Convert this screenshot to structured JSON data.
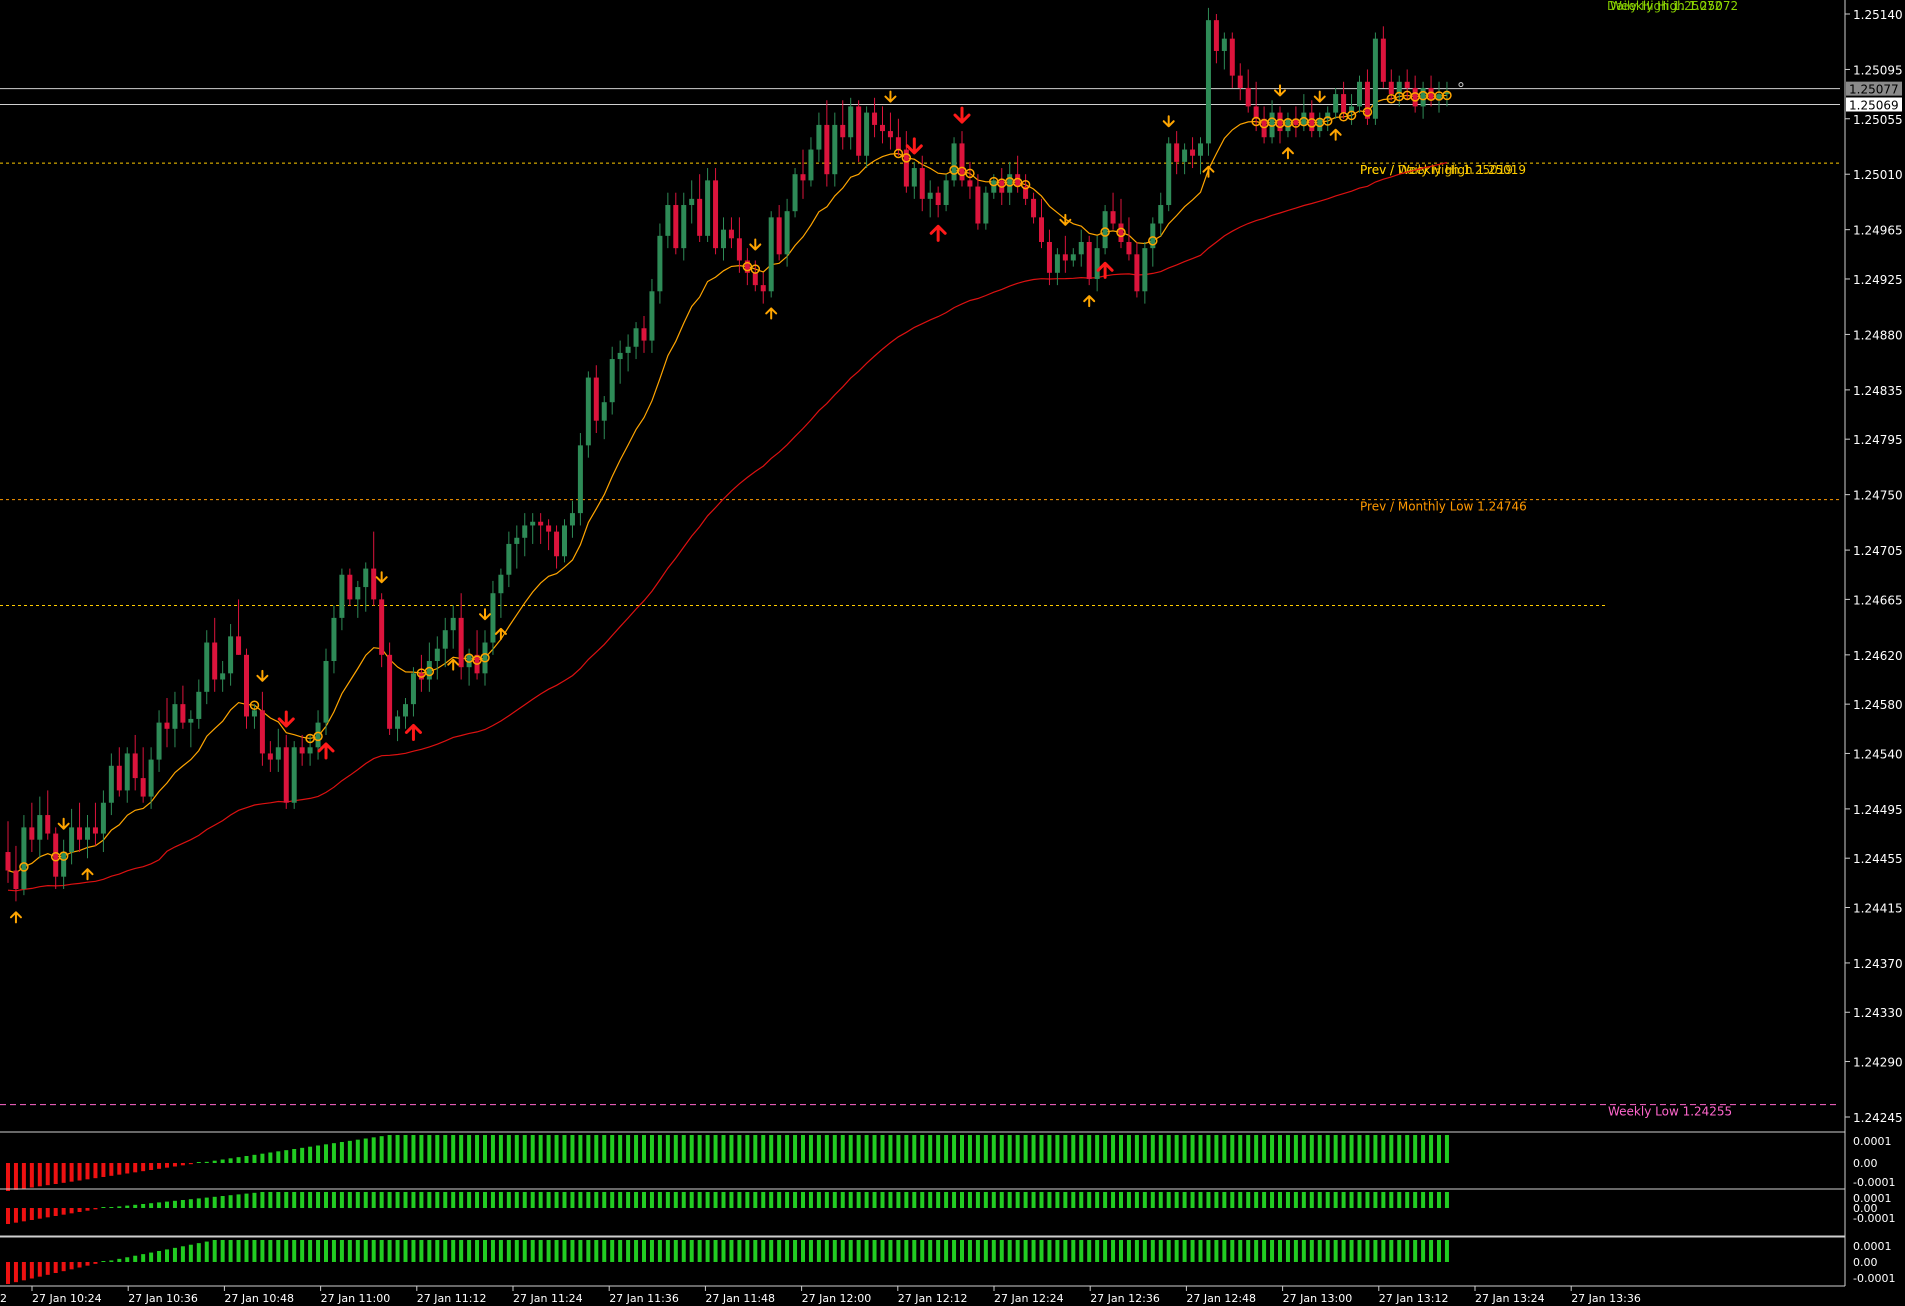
{
  "chart_data": {
    "type": "candlestick",
    "symbol_timeframe": "M1",
    "price_axis_ticks": [
      "1.25140",
      "1.25095",
      "1.25055",
      "1.25010",
      "1.24965",
      "1.24925",
      "1.24880",
      "1.24835",
      "1.24795",
      "1.24750",
      "1.24705",
      "1.24665",
      "1.24620",
      "1.24580",
      "1.24540",
      "1.24495",
      "1.24455",
      "1.24415",
      "1.24370",
      "1.24330",
      "1.24290",
      "1.24245"
    ],
    "ylim": [
      1.24225,
      1.2515
    ],
    "time_axis_ticks": [
      "27 Jan 10:24",
      "27 Jan 10:36",
      "27 Jan 10:48",
      "27 Jan 11:00",
      "27 Jan 11:12",
      "27 Jan 11:24",
      "27 Jan 11:36",
      "27 Jan 11:48",
      "27 Jan 12:00",
      "27 Jan 12:12",
      "27 Jan 12:24",
      "27 Jan 12:36",
      "27 Jan 12:48",
      "27 Jan 13:00",
      "27 Jan 13:12",
      "27 Jan 13:24",
      "27 Jan 13:36"
    ],
    "left_edge_label": "2",
    "bid_label": "1.25077",
    "ask_label": "1.25069",
    "bid_price": 1.25077,
    "ask_price": 1.25069,
    "levels": [
      {
        "label": "Weekly High 1.25072",
        "price": 1.25152,
        "color": "#8cd600",
        "style": "dash-long",
        "overlay_label": "Daily High 1.25072"
      },
      {
        "label": "Prev / Weekly High 1.25019",
        "price": 1.25019,
        "color": "#ffcc00",
        "style": "dot",
        "overlay_label": "Prev / Daily High 1.25019"
      },
      {
        "label": "Prev / Monthly Low 1.24746",
        "price": 1.24746,
        "color": "#ff9900",
        "style": "dot"
      },
      {
        "label": "",
        "price": 1.2466,
        "color": "#ffcc00",
        "style": "dot"
      },
      {
        "label": "Weekly Low 1.24255",
        "price": 1.24255,
        "color": "#ff66cc",
        "style": "dash"
      }
    ],
    "candles": [
      [
        1.2446,
        1.24485,
        1.24435,
        1.24445
      ],
      [
        1.24445,
        1.24465,
        1.2442,
        1.2443
      ],
      [
        1.2443,
        1.2449,
        1.24425,
        1.2448
      ],
      [
        1.2448,
        1.245,
        1.2446,
        1.2447
      ],
      [
        1.2447,
        1.24505,
        1.24455,
        1.2449
      ],
      [
        1.2449,
        1.2451,
        1.2447,
        1.24475
      ],
      [
        1.24475,
        1.2448,
        1.2443,
        1.2444
      ],
      [
        1.2444,
        1.2447,
        1.2443,
        1.2446
      ],
      [
        1.2446,
        1.24495,
        1.2445,
        1.2448
      ],
      [
        1.2448,
        1.245,
        1.2446,
        1.2447
      ],
      [
        1.2447,
        1.2449,
        1.24455,
        1.2448
      ],
      [
        1.2448,
        1.245,
        1.24465,
        1.24475
      ],
      [
        1.24475,
        1.2451,
        1.2446,
        1.245
      ],
      [
        1.245,
        1.2454,
        1.2449,
        1.2453
      ],
      [
        1.2453,
        1.24545,
        1.24505,
        1.2451
      ],
      [
        1.2451,
        1.24545,
        1.245,
        1.2454
      ],
      [
        1.2454,
        1.24555,
        1.2451,
        1.2452
      ],
      [
        1.2452,
        1.24545,
        1.245,
        1.24505
      ],
      [
        1.24505,
        1.24545,
        1.24495,
        1.24535
      ],
      [
        1.24535,
        1.24575,
        1.24525,
        1.24565
      ],
      [
        1.24565,
        1.24585,
        1.24545,
        1.2456
      ],
      [
        1.2456,
        1.2459,
        1.24545,
        1.2458
      ],
      [
        1.2458,
        1.24595,
        1.2456,
        1.24565
      ],
      [
        1.24565,
        1.24575,
        1.24545,
        1.24568
      ],
      [
        1.24568,
        1.246,
        1.2456,
        1.2459
      ],
      [
        1.2459,
        1.2464,
        1.2458,
        1.2463
      ],
      [
        1.2463,
        1.2465,
        1.2459,
        1.246
      ],
      [
        1.246,
        1.24615,
        1.2459,
        1.24605
      ],
      [
        1.24605,
        1.24645,
        1.24595,
        1.24635
      ],
      [
        1.24635,
        1.24665,
        1.2462,
        1.2462
      ],
      [
        1.2462,
        1.24625,
        1.2456,
        1.2457
      ],
      [
        1.2457,
        1.2458,
        1.2456,
        1.24575
      ],
      [
        1.24575,
        1.2459,
        1.2453,
        1.2454
      ],
      [
        1.2454,
        1.2455,
        1.24525,
        1.24535
      ],
      [
        1.24535,
        1.2456,
        1.24525,
        1.24545
      ],
      [
        1.24545,
        1.24555,
        1.24495,
        1.245
      ],
      [
        1.245,
        1.2455,
        1.24495,
        1.24545
      ],
      [
        1.24545,
        1.24555,
        1.2453,
        1.2454
      ],
      [
        1.2454,
        1.24555,
        1.2453,
        1.24545
      ],
      [
        1.24545,
        1.24575,
        1.24535,
        1.24565
      ],
      [
        1.24565,
        1.24625,
        1.24555,
        1.24615
      ],
      [
        1.24615,
        1.2466,
        1.24605,
        1.2465
      ],
      [
        1.2465,
        1.2469,
        1.2464,
        1.24685
      ],
      [
        1.24685,
        1.2469,
        1.2466,
        1.24665
      ],
      [
        1.24665,
        1.2468,
        1.2465,
        1.24675
      ],
      [
        1.24675,
        1.24695,
        1.24655,
        1.2469
      ],
      [
        1.2469,
        1.2472,
        1.2466,
        1.24665
      ],
      [
        1.24665,
        1.2467,
        1.2461,
        1.2462
      ],
      [
        1.2462,
        1.2463,
        1.24555,
        1.2456
      ],
      [
        1.2456,
        1.24575,
        1.2455,
        1.2457
      ],
      [
        1.2457,
        1.24585,
        1.2456,
        1.2458
      ],
      [
        1.2458,
        1.2461,
        1.2457,
        1.24605
      ],
      [
        1.24605,
        1.2462,
        1.2459,
        1.246
      ],
      [
        1.246,
        1.2463,
        1.2459,
        1.24615
      ],
      [
        1.24615,
        1.24635,
        1.246,
        1.24625
      ],
      [
        1.24625,
        1.2465,
        1.2461,
        1.2464
      ],
      [
        1.2464,
        1.2466,
        1.24625,
        1.2465
      ],
      [
        1.2465,
        1.2467,
        1.246,
        1.2461
      ],
      [
        1.2461,
        1.24625,
        1.24595,
        1.2462
      ],
      [
        1.2462,
        1.2464,
        1.246,
        1.24605
      ],
      [
        1.24605,
        1.2464,
        1.24595,
        1.2463
      ],
      [
        1.2463,
        1.2468,
        1.2462,
        1.2467
      ],
      [
        1.2467,
        1.2469,
        1.2465,
        1.24685
      ],
      [
        1.24685,
        1.2472,
        1.24675,
        1.2471
      ],
      [
        1.2471,
        1.24725,
        1.2469,
        1.24715
      ],
      [
        1.24715,
        1.24735,
        1.247,
        1.24725
      ],
      [
        1.24725,
        1.24735,
        1.2471,
        1.24728
      ],
      [
        1.24728,
        1.24735,
        1.2471,
        1.24725
      ],
      [
        1.24725,
        1.2473,
        1.24705,
        1.2472
      ],
      [
        1.2472,
        1.24725,
        1.2469,
        1.247
      ],
      [
        1.247,
        1.2473,
        1.24695,
        1.24725
      ],
      [
        1.24725,
        1.24745,
        1.24715,
        1.24735
      ],
      [
        1.24735,
        1.248,
        1.24725,
        1.2479
      ],
      [
        1.2479,
        1.2485,
        1.2478,
        1.24845
      ],
      [
        1.24845,
        1.24855,
        1.248,
        1.2481
      ],
      [
        1.2481,
        1.2483,
        1.24795,
        1.24825
      ],
      [
        1.24825,
        1.2487,
        1.24815,
        1.2486
      ],
      [
        1.2486,
        1.24875,
        1.2484,
        1.24865
      ],
      [
        1.24865,
        1.2488,
        1.2485,
        1.2487
      ],
      [
        1.2487,
        1.2489,
        1.2486,
        1.24885
      ],
      [
        1.24885,
        1.24895,
        1.24865,
        1.24875
      ],
      [
        1.24875,
        1.24925,
        1.24865,
        1.24915
      ],
      [
        1.24915,
        1.2497,
        1.24905,
        1.2496
      ],
      [
        1.2496,
        1.24995,
        1.2495,
        1.24985
      ],
      [
        1.24985,
        1.24995,
        1.24945,
        1.2495
      ],
      [
        1.2495,
        1.24995,
        1.2494,
        1.24985
      ],
      [
        1.24985,
        1.25005,
        1.2497,
        1.2499
      ],
      [
        1.2499,
        1.2501,
        1.24955,
        1.2496
      ],
      [
        1.2496,
        1.25015,
        1.24955,
        1.25005
      ],
      [
        1.25005,
        1.25015,
        1.24945,
        1.2495
      ],
      [
        1.2495,
        1.24975,
        1.2494,
        1.24965
      ],
      [
        1.24965,
        1.24975,
        1.2495,
        1.24958
      ],
      [
        1.24958,
        1.24975,
        1.2493,
        1.2494
      ],
      [
        1.2494,
        1.2495,
        1.2492,
        1.2493
      ],
      [
        1.2493,
        1.2494,
        1.24915,
        1.2492
      ],
      [
        1.2492,
        1.2493,
        1.24905,
        1.24915
      ],
      [
        1.24915,
        1.2498,
        1.2491,
        1.24975
      ],
      [
        1.24975,
        1.24985,
        1.2494,
        1.24945
      ],
      [
        1.24945,
        1.2499,
        1.24935,
        1.2498
      ],
      [
        1.2498,
        1.25015,
        1.24975,
        1.2501
      ],
      [
        1.2501,
        1.2503,
        1.2499,
        1.25005
      ],
      [
        1.25005,
        1.2504,
        1.25,
        1.2503
      ],
      [
        1.2503,
        1.2506,
        1.2502,
        1.2505
      ],
      [
        1.2505,
        1.2507,
        1.25,
        1.2501
      ],
      [
        1.2501,
        1.2506,
        1.25,
        1.2505
      ],
      [
        1.2505,
        1.2507,
        1.2503,
        1.2504
      ],
      [
        1.2504,
        1.25072,
        1.2503,
        1.25065
      ],
      [
        1.25065,
        1.2507,
        1.2502,
        1.25025
      ],
      [
        1.25025,
        1.25065,
        1.25015,
        1.2506
      ],
      [
        1.2506,
        1.25072,
        1.2504,
        1.2505
      ],
      [
        1.2505,
        1.25065,
        1.25035,
        1.25045
      ],
      [
        1.25045,
        1.2506,
        1.2503,
        1.2504
      ],
      [
        1.2504,
        1.25055,
        1.25025,
        1.2503
      ],
      [
        1.2503,
        1.25045,
        1.24995,
        1.25
      ],
      [
        1.25,
        1.2502,
        1.2499,
        1.25015
      ],
      [
        1.25015,
        1.25025,
        1.2498,
        1.2499
      ],
      [
        1.2499,
        1.25005,
        1.24975,
        1.24995
      ],
      [
        1.24995,
        1.25,
        1.24975,
        1.24985
      ],
      [
        1.24985,
        1.2501,
        1.2498,
        1.25005
      ],
      [
        1.25005,
        1.2504,
        1.25,
        1.25035
      ],
      [
        1.25035,
        1.25045,
        1.25,
        1.25005
      ],
      [
        1.25005,
        1.2502,
        1.2499,
        1.25
      ],
      [
        1.25,
        1.2501,
        1.24965,
        1.2497
      ],
      [
        1.2497,
        1.25,
        1.24965,
        1.24995
      ],
      [
        1.24995,
        1.2501,
        1.2499,
        1.25005
      ],
      [
        1.25005,
        1.25015,
        1.24985,
        1.24995
      ],
      [
        1.24995,
        1.2502,
        1.24985,
        1.2501
      ],
      [
        1.2501,
        1.25025,
        1.24995,
        1.25
      ],
      [
        1.25,
        1.2501,
        1.24985,
        1.2499
      ],
      [
        1.2499,
        1.24995,
        1.2497,
        1.24975
      ],
      [
        1.24975,
        1.2499,
        1.2495,
        1.24955
      ],
      [
        1.24955,
        1.24965,
        1.2492,
        1.2493
      ],
      [
        1.2493,
        1.2495,
        1.2492,
        1.24945
      ],
      [
        1.24945,
        1.2496,
        1.2493,
        1.2494
      ],
      [
        1.2494,
        1.2495,
        1.24935,
        1.24945
      ],
      [
        1.24945,
        1.24965,
        1.24935,
        1.24955
      ],
      [
        1.24955,
        1.2496,
        1.2492,
        1.24925
      ],
      [
        1.24925,
        1.2496,
        1.24915,
        1.2495
      ],
      [
        1.2495,
        1.24985,
        1.24945,
        1.2498
      ],
      [
        1.2498,
        1.24995,
        1.24965,
        1.2497
      ],
      [
        1.2497,
        1.2499,
        1.2495,
        1.24955
      ],
      [
        1.24955,
        1.24975,
        1.2494,
        1.24945
      ],
      [
        1.24945,
        1.24955,
        1.2491,
        1.24915
      ],
      [
        1.24915,
        1.24955,
        1.24905,
        1.2495
      ],
      [
        1.2495,
        1.24975,
        1.24935,
        1.2497
      ],
      [
        1.2497,
        1.24995,
        1.2496,
        1.24985
      ],
      [
        1.24985,
        1.2504,
        1.2498,
        1.25035
      ],
      [
        1.25035,
        1.25045,
        1.2501,
        1.2502
      ],
      [
        1.2502,
        1.25035,
        1.2501,
        1.2503
      ],
      [
        1.2503,
        1.2504,
        1.25015,
        1.25025
      ],
      [
        1.25025,
        1.2504,
        1.2501,
        1.25035
      ],
      [
        1.25035,
        1.25145,
        1.25025,
        1.25135
      ],
      [
        1.25135,
        1.2514,
        1.251,
        1.2511
      ],
      [
        1.2511,
        1.25125,
        1.25095,
        1.2512
      ],
      [
        1.2512,
        1.25125,
        1.2508,
        1.2509
      ],
      [
        1.2509,
        1.251,
        1.2507,
        1.2508
      ],
      [
        1.2508,
        1.25095,
        1.2506,
        1.25065
      ],
      [
        1.25065,
        1.25085,
        1.25045,
        1.25055
      ],
      [
        1.25055,
        1.25065,
        1.25035,
        1.2504
      ],
      [
        1.2504,
        1.2507,
        1.25035,
        1.2506
      ],
      [
        1.2506,
        1.25065,
        1.25035,
        1.25045
      ],
      [
        1.25045,
        1.2506,
        1.2504,
        1.25055
      ],
      [
        1.25055,
        1.25065,
        1.2504,
        1.2505
      ],
      [
        1.2505,
        1.25075,
        1.25045,
        1.2506
      ],
      [
        1.2506,
        1.2507,
        1.2504,
        1.25045
      ],
      [
        1.25045,
        1.2506,
        1.2504,
        1.25055
      ],
      [
        1.25055,
        1.25065,
        1.25045,
        1.2506
      ],
      [
        1.2506,
        1.2508,
        1.25055,
        1.25075
      ],
      [
        1.25075,
        1.25085,
        1.25055,
        1.2506
      ],
      [
        1.2506,
        1.25075,
        1.2505,
        1.25065
      ],
      [
        1.25065,
        1.2509,
        1.2506,
        1.25085
      ],
      [
        1.25085,
        1.25095,
        1.2505,
        1.25055
      ],
      [
        1.25055,
        1.25125,
        1.2505,
        1.2512
      ],
      [
        1.2512,
        1.2513,
        1.2508,
        1.25085
      ],
      [
        1.25085,
        1.25095,
        1.2507,
        1.25075
      ],
      [
        1.25075,
        1.2509,
        1.25065,
        1.25085
      ],
      [
        1.25085,
        1.25095,
        1.2507,
        1.2508
      ],
      [
        1.2508,
        1.2509,
        1.2506,
        1.25065
      ],
      [
        1.25065,
        1.25085,
        1.25055,
        1.2508
      ],
      [
        1.2508,
        1.2509,
        1.25065,
        1.2507
      ],
      [
        1.2507,
        1.25085,
        1.2506,
        1.25075
      ],
      [
        1.25075,
        1.25085,
        1.25065,
        1.25077
      ]
    ],
    "signal_bars_sample": [
      "up-arrow",
      "down-arrow",
      "big-up-arrow",
      "big-down-arrow"
    ],
    "colors": {
      "background": "#000000",
      "bull_candle": "#2e8b57",
      "bear_candle": "#dc143c",
      "ma_fast": "#ffa500",
      "ma_slow": "#dd1111",
      "axis_text": "#ffffff",
      "hist_positive": "#22cc22",
      "hist_negative": "#ee1111",
      "arrow_small": "#ffa500",
      "arrow_big": "#ff1a1a"
    },
    "oscillators": [
      {
        "ticks": [
          "0.0001",
          "0.00",
          "-0.0001"
        ],
        "neg_bars": 24,
        "ramp_bars": 24
      },
      {
        "ticks": [
          "0.0001",
          "0.00",
          "-0.0001"
        ],
        "neg_bars": 12,
        "ramp_bars": 20
      },
      {
        "ticks": [
          "0.0001",
          "0.00",
          "-0.0001"
        ],
        "neg_bars": 12,
        "ramp_bars": 14
      }
    ]
  }
}
